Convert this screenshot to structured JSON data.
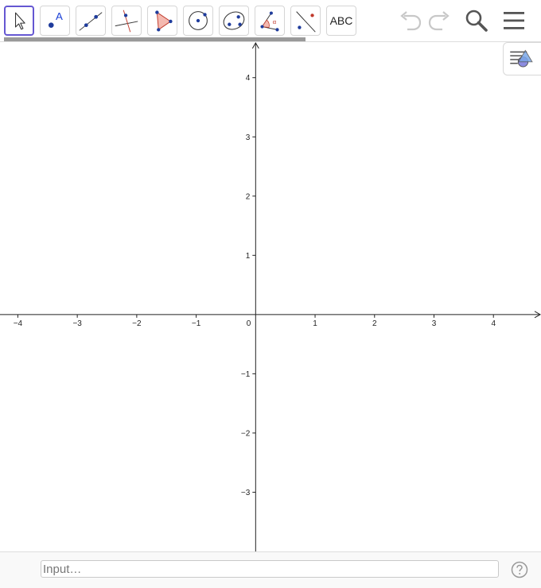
{
  "app": {
    "toolbar": {
      "tools": [
        {
          "id": "move",
          "icon": "move-arrow-icon",
          "active": true
        },
        {
          "id": "point",
          "icon": "point-icon",
          "label": "A",
          "active": false
        },
        {
          "id": "line",
          "icon": "line-icon",
          "active": false
        },
        {
          "id": "perpendicular",
          "icon": "perpendicular-line-icon",
          "active": false
        },
        {
          "id": "polygon",
          "icon": "polygon-icon",
          "active": false
        },
        {
          "id": "circle",
          "icon": "circle-center-point-icon",
          "active": false
        },
        {
          "id": "ellipse",
          "icon": "conic-ellipse-icon",
          "active": false
        },
        {
          "id": "angle",
          "icon": "angle-icon",
          "label": "α",
          "active": false
        },
        {
          "id": "reflect",
          "icon": "reflect-about-line-icon",
          "active": false
        },
        {
          "id": "text",
          "icon": "text-icon",
          "label": "ABC",
          "active": false
        }
      ],
      "undo_icon": "undo-icon",
      "redo_icon": "redo-icon",
      "search_icon": "search-icon",
      "menu_icon": "menu-icon"
    },
    "style_bar_icon": "style-bar-toggle-icon",
    "graphics": {
      "x_ticks": [
        "−4",
        "−3",
        "−2",
        "−1",
        "1",
        "2",
        "3",
        "4"
      ],
      "y_ticks": [
        "4",
        "3",
        "2",
        "1",
        "−1",
        "−2",
        "−3"
      ],
      "origin_label": "0",
      "x_range": [
        -4.3,
        4.8
      ],
      "y_range": [
        -4.0,
        4.6
      ]
    },
    "input": {
      "placeholder": "Input…",
      "value": ""
    },
    "help_icon": "help-icon",
    "colors": {
      "accent": "#6557d2",
      "point": "#1f3c9c",
      "polygon_fill": "#f4b9b0",
      "polygon_stroke": "#c0392b"
    }
  }
}
